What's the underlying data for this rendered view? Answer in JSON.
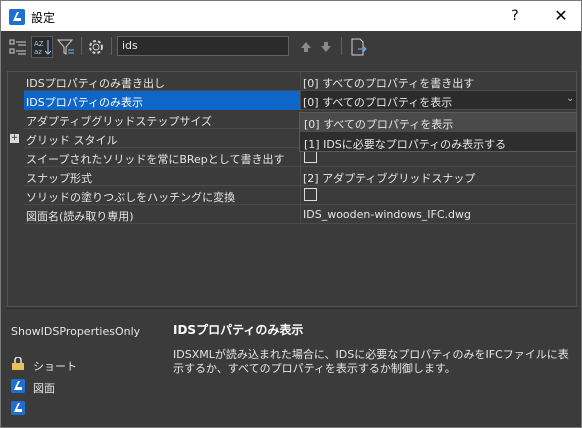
{
  "window": {
    "title": "設定",
    "help_label": "?",
    "close_label": "✕"
  },
  "toolbar": {
    "icons": [
      "categorized-icon",
      "alphabetical-icon",
      "filter-icon",
      "gear-icon",
      "move-up-icon",
      "move-down-icon",
      "export-icon"
    ],
    "search_value": "ids"
  },
  "grid": {
    "rows": [
      {
        "name": "IDSプロパティのみ書き出し",
        "value": "[0] すべてのプロパティを書き出す"
      },
      {
        "name": "IDSプロパティのみ表示",
        "value": "[0] すべてのプロパティを表示"
      },
      {
        "name": "アダプティブグリッドステップサイズ",
        "value": ""
      },
      {
        "name": "グリッド スタイル",
        "value": ""
      },
      {
        "name": "スイープされたソリッドを常にBRepとして書き出す",
        "value": ""
      },
      {
        "name": "スナップ形式",
        "value": "[2] アダプティブグリッドスナップ"
      },
      {
        "name": "ソリッドの塗りつぶしをハッチングに変換",
        "value": ""
      },
      {
        "name": "図面名(読み取り専用)",
        "value": "IDS_wooden-windows_IFC.dwg"
      }
    ],
    "dropdown_options": [
      "[0] すべてのプロパティを表示",
      "[1] IDSに必要なプロパティのみ表示する"
    ]
  },
  "detail": {
    "property_key": "ShowIDSPropertiesOnly",
    "title": "IDSプロパティのみ表示",
    "description": "IDSXMLが読み込まれた場合に、IDSに必要なプロパティのみをIFCファイルに表示するか、すべてのプロパティを表示するか制御します。"
  },
  "sidebar": {
    "items": [
      {
        "label": "ショート",
        "icon": "shortcut-icon"
      },
      {
        "label": "図面",
        "icon": "drawing-icon"
      },
      {
        "label": "",
        "icon": "app-icon"
      }
    ]
  },
  "colors": {
    "accent": "#0e66c8",
    "background": "#3b3b3b",
    "app_blue": "#1e6fd1"
  }
}
